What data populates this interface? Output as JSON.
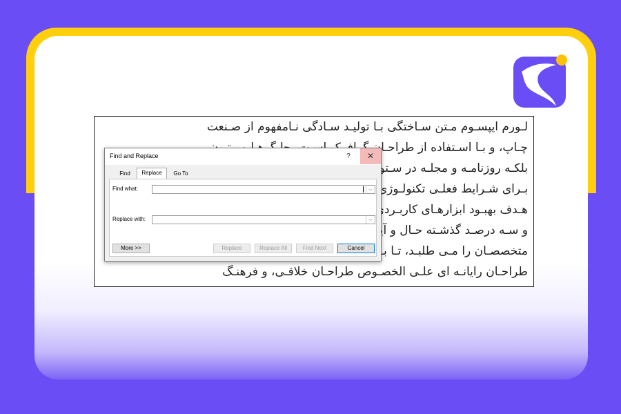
{
  "document": {
    "lines": [
      "لـورم ایپسـوم مـتن سـاختگی بـا تولیـد سـادگی نـامفهوم از صـنعت",
      "چـاپ، و بـا اسـتفاده از طراحـان گرافیـک اسـت، چاپگرهـا و متـون",
      "بلکـه روزنامـه و مجلـه در سـتون و سـطرآنچنان کـه لازم اسـت، و",
      "بـرای شـرایط فعلـی تکنولـوژی مـورد نیـاز، و کاربردهـای متنـوع بـا",
      "هـدف بهبـود ابزارهـای کاربـردی مـی باشـد، کتابهـای زیـادی در شـصت",
      "و سـه درصـد گذشـته حـال و آینـده، شـناخت فـراوان جامعـه و",
      "متخصصـان را مـی طلبـد، تـا بـا نـرم افزارهـا شـناخت بیشـتری را بـرای",
      "طراحـان رایانـه ای علـی الخصـوص طراحـان خلاقـی، و فرهنـگ"
    ]
  },
  "dialog": {
    "title": "Find and Replace",
    "help": "?",
    "close": "✕",
    "tabs": [
      "Find",
      "Replace",
      "Go To"
    ],
    "find_label": "Find what:",
    "find_value": "",
    "replace_label": "Replace with:",
    "replace_value": "",
    "buttons": {
      "more": "More >>",
      "replace": "Replace",
      "replace_all": "Replace All",
      "find_next": "Find Next",
      "cancel": "Cancel"
    },
    "dropdown_arrow": "⌵"
  },
  "colors": {
    "brand": "#6a4df5",
    "accent": "#ffcf0d",
    "close_hover": "#f4b9b9"
  },
  "icons": {
    "logo": "brand-s-logo-icon"
  }
}
